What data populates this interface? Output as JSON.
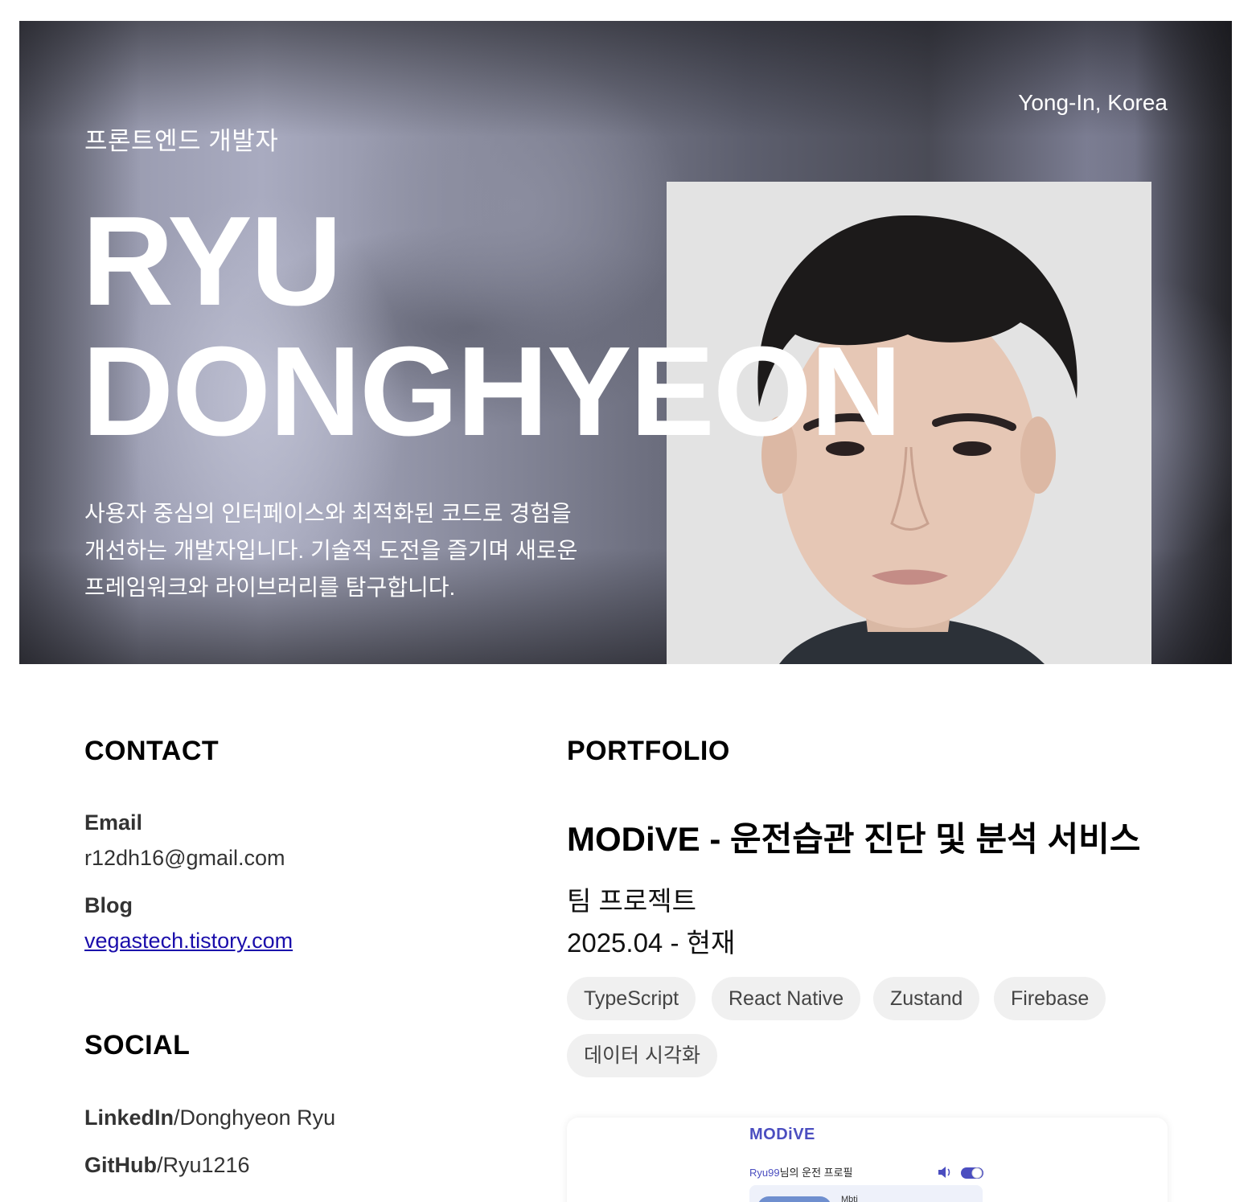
{
  "hero": {
    "role": "프론트엔드 개발자",
    "location": "Yong-In, Korea",
    "name_line1": "RYU",
    "name_line2": "DONGHYEON",
    "description": "사용자 중심의 인터페이스와 최적화된 코드로 경험을 개선하는 개발자입니다. 기술적 도전을 즐기며 새로운 프레임워크와 라이브러리를 탐구합니다."
  },
  "contact": {
    "title": "CONTACT",
    "email_label": "Email",
    "email": "r12dh16@gmail.com",
    "blog_label": "Blog",
    "blog": "vegastech.tistory.com"
  },
  "social": {
    "title": "SOCIAL",
    "items": [
      {
        "label": "LinkedIn",
        "value": "/Donghyeon Ryu"
      },
      {
        "label": "GitHub",
        "value": "/Ryu1216"
      }
    ]
  },
  "portfolio": {
    "title": "PORTFOLIO",
    "project": {
      "title": "MODiVE - 운전습관 진단 및 분석 서비스",
      "type": "팀 프로젝트",
      "period": "2025.04 - 현재",
      "tags": [
        "TypeScript",
        "React Native",
        "Zustand",
        "Firebase",
        "데이터 시각화"
      ],
      "preview": {
        "logo": "MODiVE",
        "user": "Ryu99",
        "profile_suffix": "님의 운전 프로필",
        "mbti_label": "Mbti",
        "accent": "#4b4ec0"
      }
    }
  }
}
